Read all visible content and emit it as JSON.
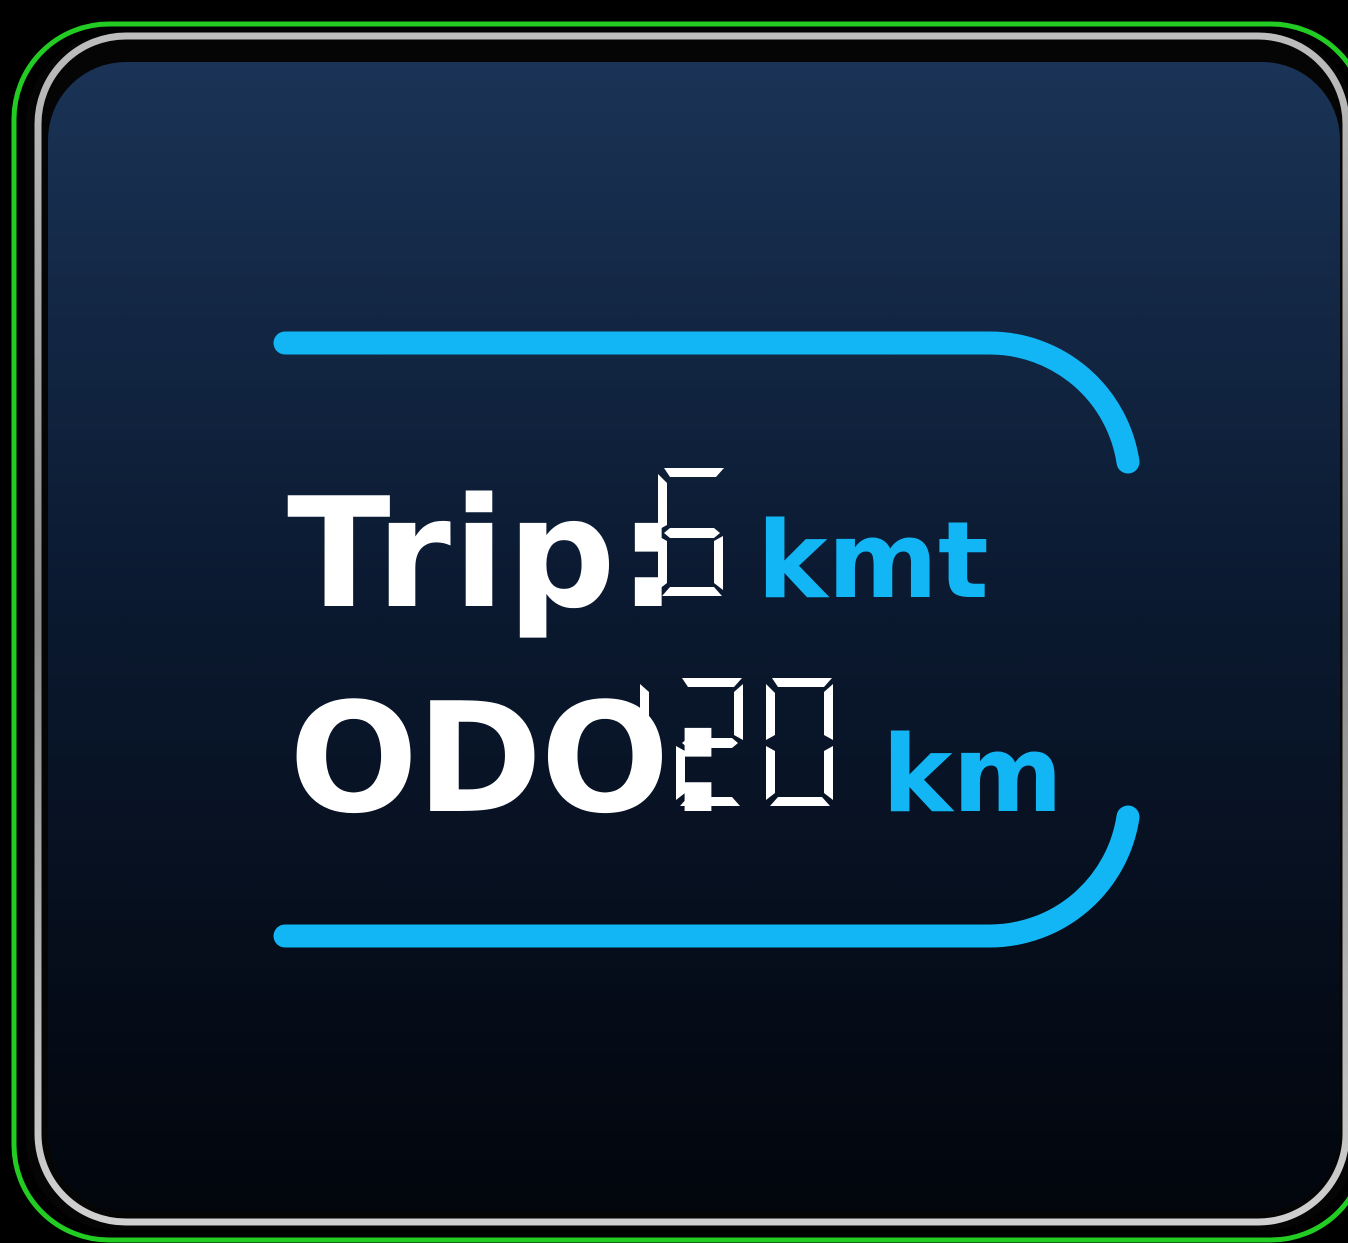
{
  "colors": {
    "accent": "#13b6f5",
    "text": "#ffffff",
    "panel_top": "#1a3356",
    "panel_bottom": "#02050c",
    "outer_glow": "#22cc22"
  },
  "trip": {
    "label": "Trip:",
    "value": "6",
    "unit": "kmt"
  },
  "odo": {
    "label": "ODO:",
    "value": "120",
    "unit": "km"
  }
}
